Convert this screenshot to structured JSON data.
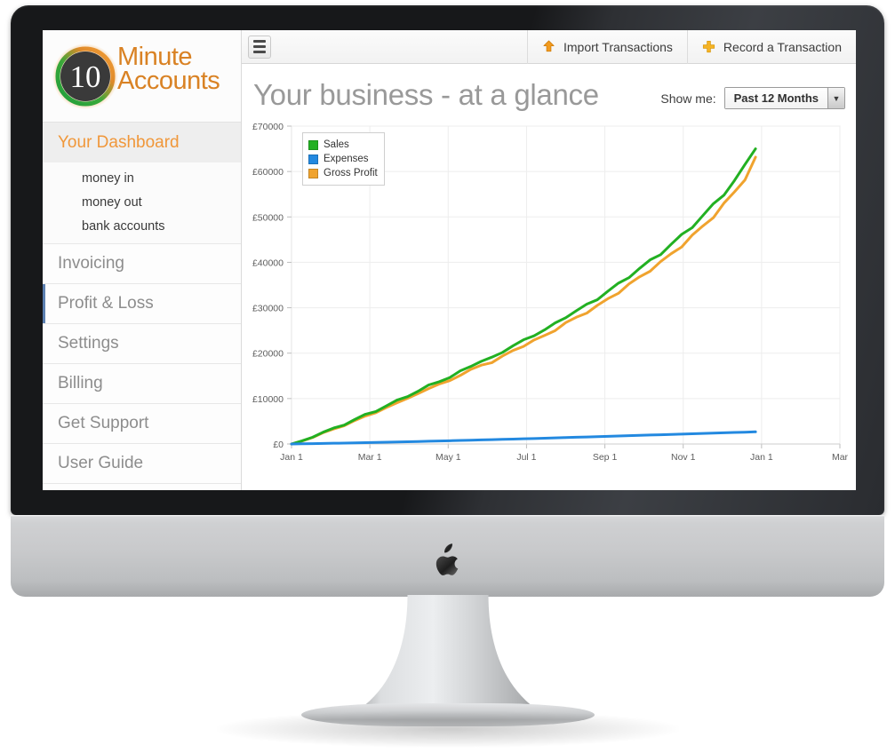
{
  "device": {
    "brand_icon": "apple-logo"
  },
  "sidebar": {
    "logo": {
      "badge_text": "10",
      "line1": "Minute",
      "line2": "Accounts"
    },
    "items": [
      {
        "label": "Your Dashboard",
        "active": true
      },
      {
        "label": "Invoicing",
        "active": false
      },
      {
        "label": "Profit & Loss",
        "active": false
      },
      {
        "label": "Settings",
        "active": false
      },
      {
        "label": "Billing",
        "active": false
      },
      {
        "label": "Get Support",
        "active": false
      },
      {
        "label": "User Guide",
        "active": false
      }
    ],
    "sub_items": [
      {
        "label": "money in"
      },
      {
        "label": "money out"
      },
      {
        "label": "bank accounts"
      }
    ]
  },
  "toolbar": {
    "menu_icon": "hamburger-icon",
    "buttons": [
      {
        "label": "Import Transactions",
        "icon": "upload-arrow-icon"
      },
      {
        "label": "Record a Transaction",
        "icon": "plus-icon"
      }
    ]
  },
  "header": {
    "title": "Your business - at a glance",
    "show_me_label": "Show me:",
    "range_value": "Past 12 Months",
    "range_options": [
      "Past 12 Months"
    ]
  },
  "colors": {
    "sales": "#22b022",
    "expenses": "#2389e0",
    "gross_profit": "#f0a32e",
    "accent_orange": "#f0973a",
    "logo_orange": "#d98224",
    "sidebar_text": "#8d8d8d"
  },
  "chart_data": {
    "type": "line",
    "title": "",
    "xlabel": "",
    "ylabel": "",
    "ylim": [
      0,
      70000
    ],
    "yticks": [
      0,
      10000,
      20000,
      30000,
      40000,
      50000,
      60000,
      70000
    ],
    "ytick_labels": [
      "£0",
      "£10000",
      "£20000",
      "£30000",
      "£40000",
      "£50000",
      "£60000",
      "£70000"
    ],
    "xtick_labels": [
      "Jan 1",
      "Mar 1",
      "May 1",
      "Jul 1",
      "Sep 1",
      "Nov 1",
      "Jan 1",
      "Mar"
    ],
    "grid": true,
    "legend_position": "top-left",
    "x": [
      0,
      1,
      2,
      3,
      4,
      5,
      6,
      7,
      8,
      9,
      10,
      11,
      12,
      13,
      14,
      15,
      16,
      17,
      18,
      19,
      20,
      21,
      22,
      23,
      24,
      25,
      26,
      27,
      28,
      29,
      30,
      31,
      32,
      33,
      34,
      35,
      36,
      37,
      38,
      39,
      40,
      41,
      42,
      43,
      44
    ],
    "series": [
      {
        "name": "Sales",
        "color": "#22b022",
        "values": [
          0,
          700,
          1500,
          2600,
          3500,
          4200,
          5400,
          6500,
          7200,
          8400,
          9600,
          10500,
          11600,
          12900,
          13800,
          14600,
          16000,
          17200,
          18200,
          19000,
          20300,
          21600,
          22800,
          24000,
          25100,
          26500,
          28000,
          29300,
          30600,
          32000,
          33600,
          35200,
          36900,
          38600,
          40300,
          42000,
          43900,
          45900,
          48000,
          50200,
          52600,
          55200,
          57900,
          61200,
          65500
        ]
      },
      {
        "name": "Expenses",
        "color": "#2389e0",
        "values": [
          0,
          40,
          80,
          120,
          160,
          200,
          250,
          300,
          350,
          400,
          450,
          500,
          550,
          600,
          660,
          720,
          780,
          840,
          900,
          960,
          1020,
          1080,
          1140,
          1200,
          1270,
          1340,
          1410,
          1480,
          1550,
          1620,
          1690,
          1760,
          1830,
          1900,
          1970,
          2040,
          2110,
          2180,
          2250,
          2320,
          2390,
          2460,
          2530,
          2600,
          2680
        ]
      },
      {
        "name": "Gross Profit",
        "color": "#f0a32e",
        "values": [
          0,
          660,
          1420,
          2480,
          3340,
          4000,
          5150,
          6200,
          6850,
          8000,
          9150,
          10000,
          11050,
          12300,
          13140,
          13900,
          15220,
          16360,
          17300,
          18050,
          19280,
          20520,
          21660,
          22800,
          23830,
          25160,
          26590,
          27820,
          29050,
          30380,
          31910,
          33440,
          35070,
          36700,
          38330,
          39960,
          41790,
          43720,
          45750,
          47880,
          50210,
          52740,
          55370,
          58600,
          62820
        ]
      }
    ]
  }
}
